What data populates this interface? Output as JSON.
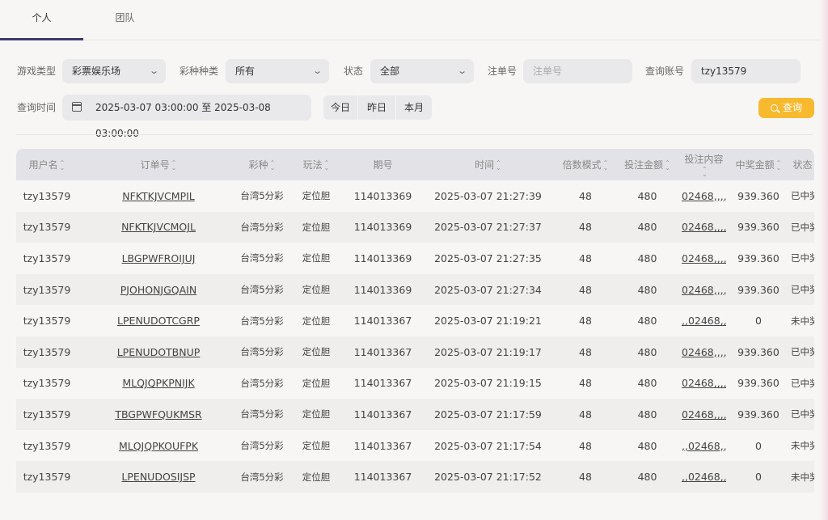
{
  "tabs": [
    {
      "label": "个人"
    },
    {
      "label": "团队"
    }
  ],
  "filters": {
    "game_type_label": "游戏类型",
    "game_type_value": "彩票娱乐场",
    "lottery_type_label": "彩种种类",
    "lottery_type_value": "所有",
    "status_label": "状态",
    "status_value": "全部",
    "order_no_label": "注单号",
    "order_no_placeholder": "注单号",
    "account_label": "查询账号",
    "account_value": "tzy13579",
    "time_label": "查询时间",
    "date_range": "2025-03-07 03:00:00 至 2025-03-08 03:00:00",
    "quick_today": "今日",
    "quick_yesterday": "昨日",
    "quick_month": "本月",
    "search_label": "查询"
  },
  "table": {
    "columns": [
      "用户名",
      "订单号",
      "彩种",
      "玩法",
      "期号",
      "时间",
      "倍数模式",
      "投注金额",
      "投注内容",
      "中奖金额",
      "状态"
    ],
    "sortable": [
      true,
      true,
      true,
      true,
      false,
      true,
      true,
      true,
      true,
      true,
      false
    ],
    "rows": [
      [
        "tzy13579",
        "NFKTKJVCMPIL",
        "台湾5分彩",
        "定位胆",
        "114013369",
        "2025-03-07 21:27:39",
        "48",
        "480",
        "02468,,,,",
        "939.360",
        "已中奖"
      ],
      [
        "tzy13579",
        "NFKTKJVCMOJL",
        "台湾5分彩",
        "定位胆",
        "114013369",
        "2025-03-07 21:27:37",
        "48",
        "480",
        "02468,,,,",
        "939.360",
        "已中奖"
      ],
      [
        "tzy13579",
        "LBGPWFROIJUJ",
        "台湾5分彩",
        "定位胆",
        "114013369",
        "2025-03-07 21:27:35",
        "48",
        "480",
        "02468,,,,",
        "939.360",
        "已中奖"
      ],
      [
        "tzy13579",
        "PJOHONJGQAIN",
        "台湾5分彩",
        "定位胆",
        "114013369",
        "2025-03-07 21:27:34",
        "48",
        "480",
        "02468,,,,",
        "939.360",
        "已中奖"
      ],
      [
        "tzy13579",
        "LPENUDOTCGRP",
        "台湾5分彩",
        "定位胆",
        "114013367",
        "2025-03-07 21:19:21",
        "48",
        "480",
        ",,02468,,",
        "0",
        "未中奖"
      ],
      [
        "tzy13579",
        "LPENUDOTBNUP",
        "台湾5分彩",
        "定位胆",
        "114013367",
        "2025-03-07 21:19:17",
        "48",
        "480",
        "02468,,,,",
        "939.360",
        "已中奖"
      ],
      [
        "tzy13579",
        "MLQJQPKPNIJK",
        "台湾5分彩",
        "定位胆",
        "114013367",
        "2025-03-07 21:19:15",
        "48",
        "480",
        "02468,,,,",
        "939.360",
        "已中奖"
      ],
      [
        "tzy13579",
        "TBGPWFQUKMSR",
        "台湾5分彩",
        "定位胆",
        "114013367",
        "2025-03-07 21:17:59",
        "48",
        "480",
        "02468,,,,",
        "939.360",
        "已中奖"
      ],
      [
        "tzy13579",
        "MLQJQPKOUFPK",
        "台湾5分彩",
        "定位胆",
        "114013367",
        "2025-03-07 21:17:54",
        "48",
        "480",
        ",,02468,,",
        "0",
        "未中奖"
      ],
      [
        "tzy13579",
        "LPENUDOSIJSP",
        "台湾5分彩",
        "定位胆",
        "114013367",
        "2025-03-07 21:17:52",
        "48",
        "480",
        ",,02468,,",
        "0",
        "未中奖"
      ]
    ]
  },
  "colors": {
    "accent": "#3c3a72",
    "search_button": "#f7b92e"
  }
}
